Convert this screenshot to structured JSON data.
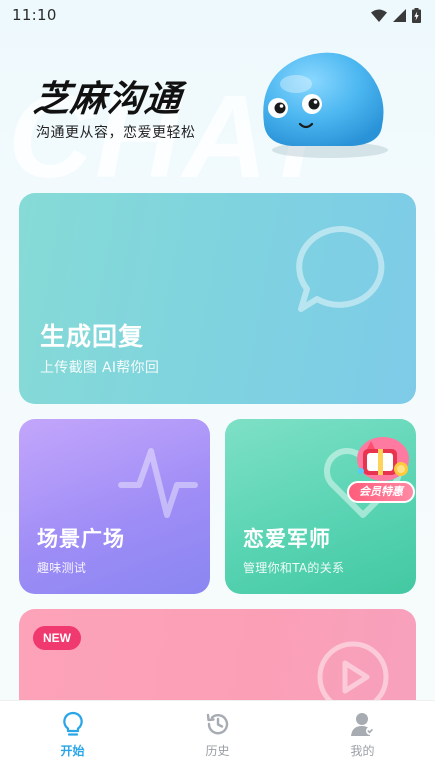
{
  "status_bar": {
    "time": "11:10",
    "icons": [
      "wifi-icon",
      "cell-signal-icon",
      "battery-charging-icon"
    ]
  },
  "header": {
    "watermark": "CHAT",
    "app_title": "芝麻沟通",
    "subtitle": "沟通更从容，恋爱更轻松",
    "mascot": "blue-blob-mascot"
  },
  "cards": {
    "reply": {
      "title": "生成回复",
      "desc": "上传截图 AI帮你回",
      "icon": "chat-bubble-icon"
    },
    "scene": {
      "title": "场景广场",
      "desc": "趣味测试",
      "icon": "pulse-wave-icon"
    },
    "love": {
      "title": "恋爱军师",
      "desc": "管理你和TA的关系",
      "icon": "heart-outline-icon",
      "badge": "会员特惠"
    },
    "new": {
      "badge": "NEW",
      "icon": "play-circle-icon"
    }
  },
  "tabs": [
    {
      "label": "开始",
      "icon": "lightbulb-icon",
      "active": true
    },
    {
      "label": "历史",
      "icon": "history-icon",
      "active": false
    },
    {
      "label": "我的",
      "icon": "user-icon",
      "active": false
    }
  ],
  "colors": {
    "accent": "#2aa6e8",
    "new_badge": "#f0396f"
  }
}
